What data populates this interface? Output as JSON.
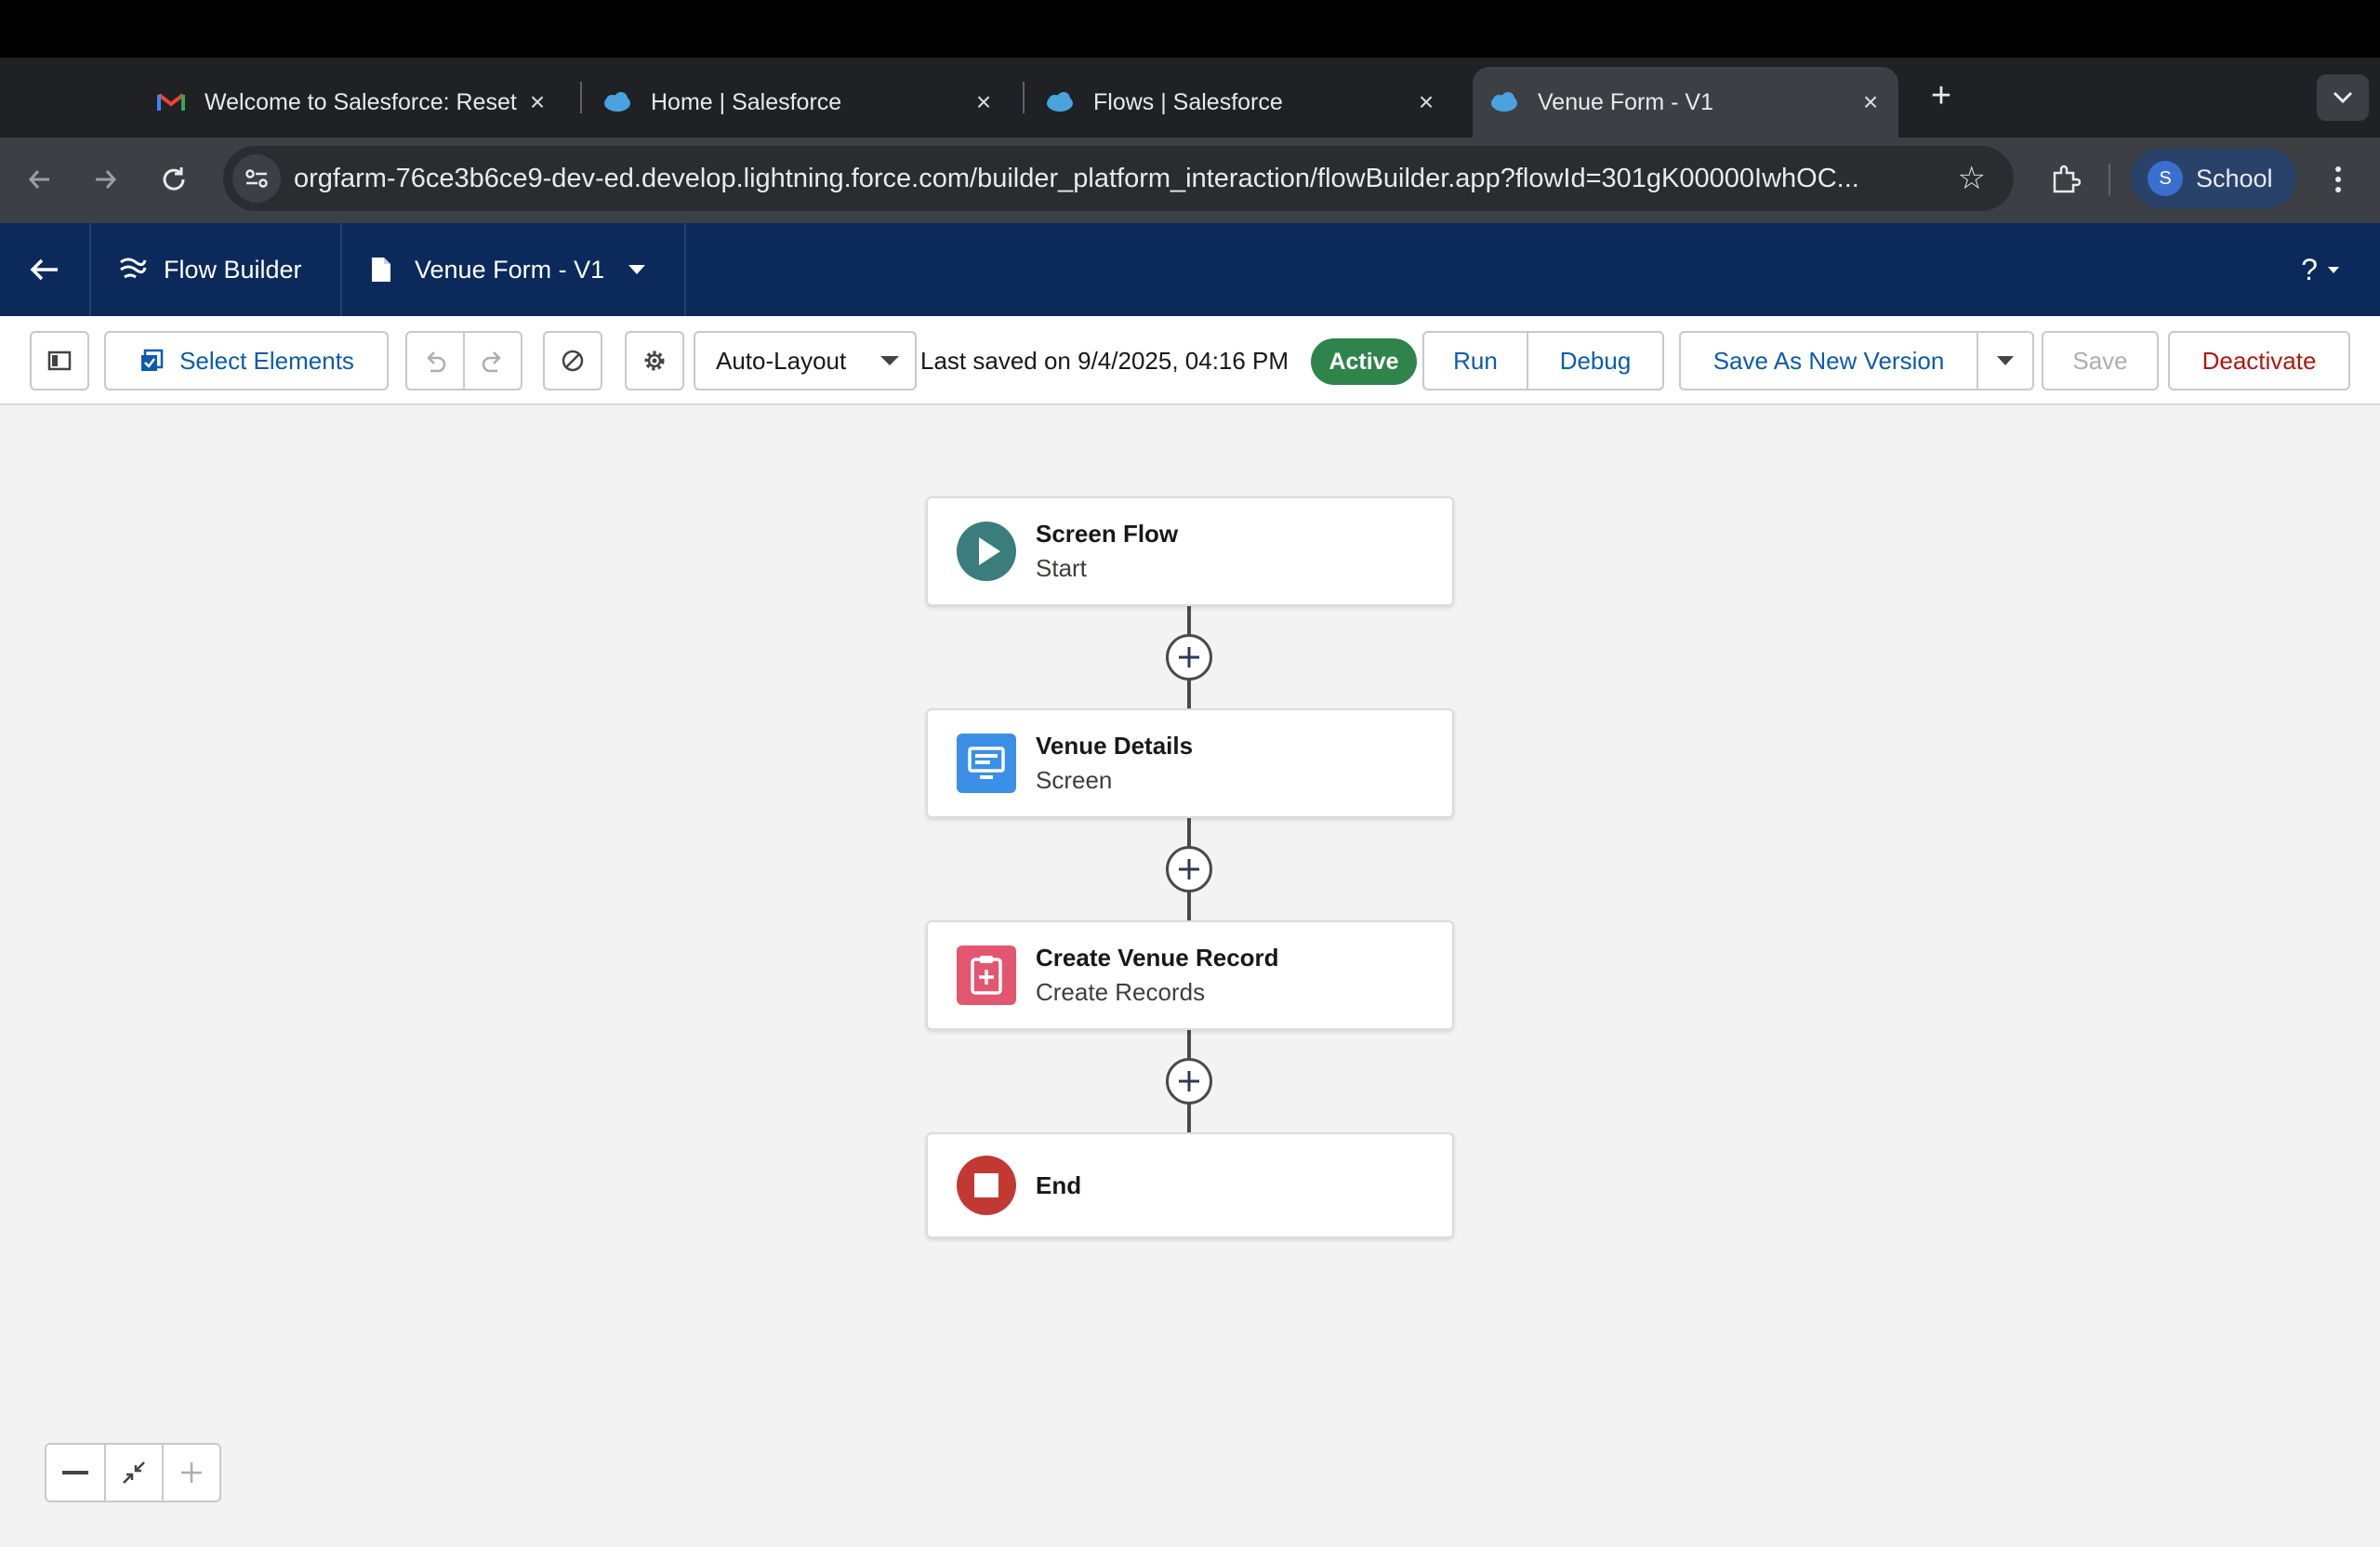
{
  "browser": {
    "tabs": [
      {
        "title": "Welcome to Salesforce: Reset",
        "icon": "gmail-icon"
      },
      {
        "title": "Home | Salesforce",
        "icon": "salesforce-cloud-icon"
      },
      {
        "title": "Flows | Salesforce",
        "icon": "salesforce-cloud-icon"
      },
      {
        "title": "Venue Form - V1",
        "icon": "salesforce-cloud-icon",
        "active": true
      }
    ],
    "url": "orgfarm-76ce3b6ce9-dev-ed.develop.lightning.force.com/builder_platform_interaction/flowBuilder.app?flowId=301gK00000IwhOC...",
    "profile": {
      "initial": "S",
      "name": "School"
    }
  },
  "header": {
    "app_name": "Flow Builder",
    "flow_name": "Venue Form - V1",
    "help_label": "?"
  },
  "toolbar": {
    "select_elements": "Select Elements",
    "layout_mode": "Auto-Layout",
    "last_saved": "Last saved on 9/4/2025, 04:16 PM",
    "status": "Active",
    "run": "Run",
    "debug": "Debug",
    "save_as_new": "Save As New Version",
    "save": "Save",
    "deactivate": "Deactivate"
  },
  "flow": {
    "nodes": [
      {
        "title": "Screen Flow",
        "subtitle": "Start",
        "icon": "play-icon",
        "color": "#3a7d7c"
      },
      {
        "title": "Venue Details",
        "subtitle": "Screen",
        "icon": "screen-icon",
        "color": "#3b8fe6"
      },
      {
        "title": "Create Venue Record",
        "subtitle": "Create Records",
        "icon": "create-record-icon",
        "color": "#e3566f"
      },
      {
        "title": "End",
        "subtitle": "",
        "icon": "stop-icon",
        "color": "#c23934"
      }
    ]
  },
  "colors": {
    "header_bg": "#0b2a5b",
    "active_badge": "#2e844a",
    "brand_link": "#0b5cab",
    "deactivate": "#b0180e"
  }
}
